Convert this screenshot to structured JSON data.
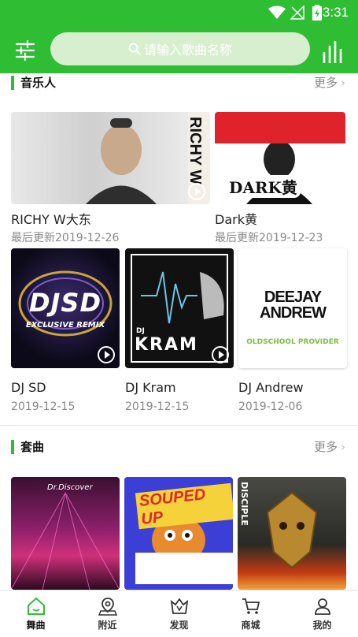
{
  "status_bar": {
    "time": "3:31"
  },
  "header": {
    "search_placeholder": "请输入歌曲名称"
  },
  "sections": {
    "artists": {
      "title": "音乐人",
      "more": "更多",
      "cards": [
        {
          "name": "RICHY W大东",
          "date": "最后更新2019-12-26",
          "art_text": "RICHY W"
        },
        {
          "name": "Dark黄",
          "date": "最后更新2019-12-23",
          "art_text": "DARK黄"
        },
        {
          "name": "DJ SD",
          "date": "2019-12-15",
          "art_text": "DJSD",
          "art_sub": "EXCLUSIVE REMIX"
        },
        {
          "name": "DJ Kram",
          "date": "2019-12-15",
          "art_text": "KRAM",
          "art_sub": "DJ"
        },
        {
          "name": "DJ Andrew",
          "date": "2019-12-06",
          "art_text": "DEEJAY ANDREW",
          "art_sub": "OLDSCHOOL PROVIDER"
        }
      ]
    },
    "sets": {
      "title": "套曲",
      "more": "更多",
      "cards": [
        {
          "art_text": "Dr.Discover"
        },
        {
          "art_text": "SOUPED UP"
        },
        {
          "art_text": "DISCIPLE"
        }
      ]
    }
  },
  "bottom_nav": [
    {
      "label": "舞曲",
      "icon": "home-icon",
      "active": true
    },
    {
      "label": "附近",
      "icon": "location-icon"
    },
    {
      "label": "发现",
      "icon": "discover-icon"
    },
    {
      "label": "商城",
      "icon": "cart-icon"
    },
    {
      "label": "我的",
      "icon": "user-icon"
    }
  ],
  "colors": {
    "brand": "#2fbe33",
    "search_bg": "#d8efcf"
  }
}
